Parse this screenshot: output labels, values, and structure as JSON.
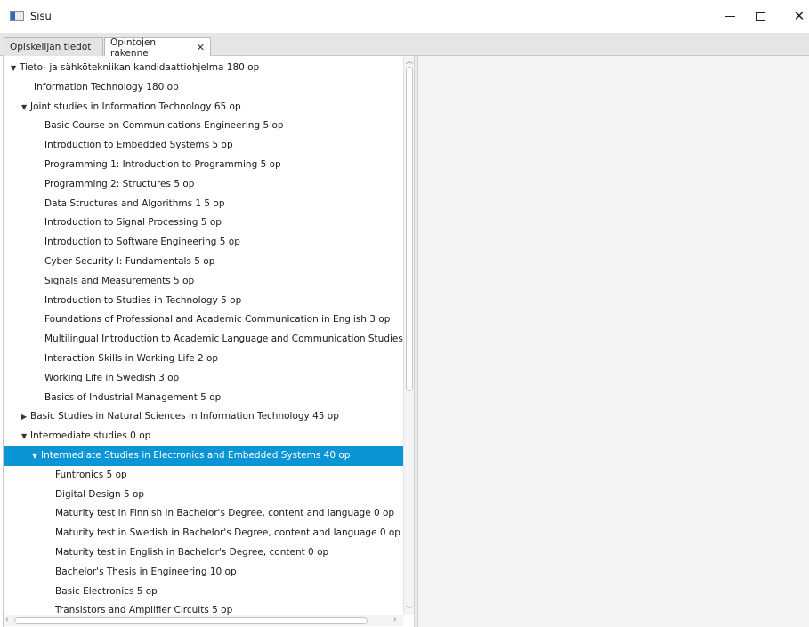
{
  "window": {
    "title": "Sisu",
    "minimize_glyph": "",
    "maximize_glyph": "",
    "close_glyph": "✕"
  },
  "tabs": [
    {
      "label": "Opiskelijan tiedot",
      "closable": false,
      "active": false
    },
    {
      "label": "Opintojen rakenne",
      "close_glyph": "✕",
      "active": true
    }
  ],
  "tree": {
    "rows": [
      {
        "text": "Tieto- ja sähkötekniikan kandidaattiohjelma 180 op",
        "level": 0,
        "expander": "▼"
      },
      {
        "text": "Information Technology 180 op",
        "level": 2,
        "expander": ""
      },
      {
        "text": "Joint studies in Information Technology 65 op",
        "level": 1,
        "expander": "▼"
      },
      {
        "text": "Basic Course on Communications Engineering 5 op",
        "level": 3,
        "expander": ""
      },
      {
        "text": "Introduction to Embedded Systems 5 op",
        "level": 3,
        "expander": ""
      },
      {
        "text": "Programming 1: Introduction to Programming 5 op",
        "level": 3,
        "expander": ""
      },
      {
        "text": "Programming 2: Structures 5 op",
        "level": 3,
        "expander": ""
      },
      {
        "text": "Data Structures and Algorithms 1 5 op",
        "level": 3,
        "expander": ""
      },
      {
        "text": "Introduction to Signal Processing 5 op",
        "level": 3,
        "expander": ""
      },
      {
        "text": "Introduction to Software Engineering 5 op",
        "level": 3,
        "expander": ""
      },
      {
        "text": "Cyber Security I: Fundamentals 5 op",
        "level": 3,
        "expander": ""
      },
      {
        "text": "Signals and Measurements 5 op",
        "level": 3,
        "expander": ""
      },
      {
        "text": "Introduction to Studies in Technology 5 op",
        "level": 3,
        "expander": ""
      },
      {
        "text": "Foundations of Professional and Academic Communication in English 3 op",
        "level": 3,
        "expander": ""
      },
      {
        "text": "Multilingual Introduction to Academic Language and Communication Studies ...",
        "level": 3,
        "expander": ""
      },
      {
        "text": "Interaction Skills in Working Life 2 op",
        "level": 3,
        "expander": ""
      },
      {
        "text": "Working Life in Swedish 3 op",
        "level": 3,
        "expander": ""
      },
      {
        "text": "Basics of Industrial Management 5 op",
        "level": 3,
        "expander": ""
      },
      {
        "text": "Basic Studies in Natural Sciences in Information Technology 45 op",
        "level": 1,
        "expander": "▶"
      },
      {
        "text": "Intermediate studies 0 op",
        "level": 1,
        "expander": "▼"
      },
      {
        "text": "Intermediate Studies in Electronics and Embedded Systems 40 op",
        "level": 2,
        "expander": "▼",
        "selected": true
      },
      {
        "text": "Funtronics 5 op",
        "level": 4,
        "expander": ""
      },
      {
        "text": "Digital Design 5 op",
        "level": 4,
        "expander": ""
      },
      {
        "text": "Maturity test in Finnish in Bachelor's Degree, content and language 0 op",
        "level": 4,
        "expander": ""
      },
      {
        "text": "Maturity test in Swedish in Bachelor's Degree, content and language 0 op",
        "level": 4,
        "expander": ""
      },
      {
        "text": "Maturity test in English in Bachelor's Degree, content 0 op",
        "level": 4,
        "expander": ""
      },
      {
        "text": "Bachelor's Thesis in Engineering 10 op",
        "level": 4,
        "expander": ""
      },
      {
        "text": "Basic Electronics 5 op",
        "level": 4,
        "expander": ""
      },
      {
        "text": "Transistors and Amplifier Circuits 5 op",
        "level": 4,
        "expander": ""
      }
    ]
  },
  "scrollbars": {
    "vertical": {
      "up_glyph": "︿",
      "down_glyph": "﹀"
    },
    "horizontal": {
      "left_glyph": "‹",
      "right_glyph": "›"
    }
  },
  "colors": {
    "selection": "#0a96d6",
    "selection_text": "#ffffff",
    "tabbar": "#e6e6e6",
    "right_pane": "#f4f4f4"
  }
}
